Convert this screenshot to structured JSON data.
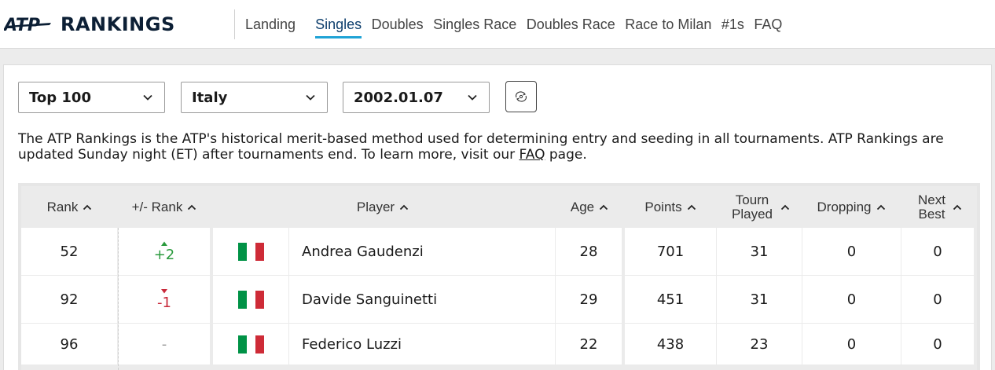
{
  "header": {
    "logo_text": "RANKINGS",
    "logo_mark": "ATP",
    "nav": [
      {
        "label": "Landing",
        "active": false
      },
      {
        "label": "Singles",
        "active": true
      },
      {
        "label": "Doubles",
        "active": false
      },
      {
        "label": "Singles Race",
        "active": false
      },
      {
        "label": "Doubles Race",
        "active": false
      },
      {
        "label": "Race to Milan",
        "active": false
      },
      {
        "label": "#1s",
        "active": false
      },
      {
        "label": "FAQ",
        "active": false
      }
    ]
  },
  "filters": {
    "range": "Top 100",
    "country": "Italy",
    "date": "2002.01.07",
    "reset_icon": "refresh-icon"
  },
  "description": {
    "text_before": "The ATP Rankings is the ATP's historical merit-based method used for determining entry and seeding in all tournaments. ATP Rankings are updated Sunday night (ET) after tournaments end. To learn more, visit our ",
    "link": "FAQ",
    "text_after": " page."
  },
  "table": {
    "columns": [
      {
        "key": "rank",
        "label": "Rank"
      },
      {
        "key": "change",
        "label": "+/- Rank"
      },
      {
        "key": "player",
        "label": "Player"
      },
      {
        "key": "age",
        "label": "Age"
      },
      {
        "key": "points",
        "label": "Points"
      },
      {
        "key": "played",
        "label": "Tourn Played"
      },
      {
        "key": "dropping",
        "label": "Dropping"
      },
      {
        "key": "next_best",
        "label": "Next Best"
      }
    ],
    "rows": [
      {
        "rank": "52",
        "change": "+2",
        "direction": "up",
        "flag": "italy-flag",
        "player": "Andrea Gaudenzi",
        "age": "28",
        "points": "701",
        "played": "31",
        "dropping": "0",
        "next_best": "0"
      },
      {
        "rank": "92",
        "change": "-1",
        "direction": "down",
        "flag": "italy-flag",
        "player": "Davide Sanguinetti",
        "age": "29",
        "points": "451",
        "played": "31",
        "dropping": "0",
        "next_best": "0"
      },
      {
        "rank": "96",
        "change": "-",
        "direction": "same",
        "flag": "italy-flag",
        "player": "Federico Luzzi",
        "age": "22",
        "points": "438",
        "played": "23",
        "dropping": "0",
        "next_best": "0"
      }
    ]
  },
  "colors": {
    "accent": "#1fa3d6",
    "up": "#2a9a3d",
    "down": "#c8293a",
    "flag_green": "#009246",
    "flag_white": "#ffffff",
    "flag_red": "#ce2b37"
  }
}
